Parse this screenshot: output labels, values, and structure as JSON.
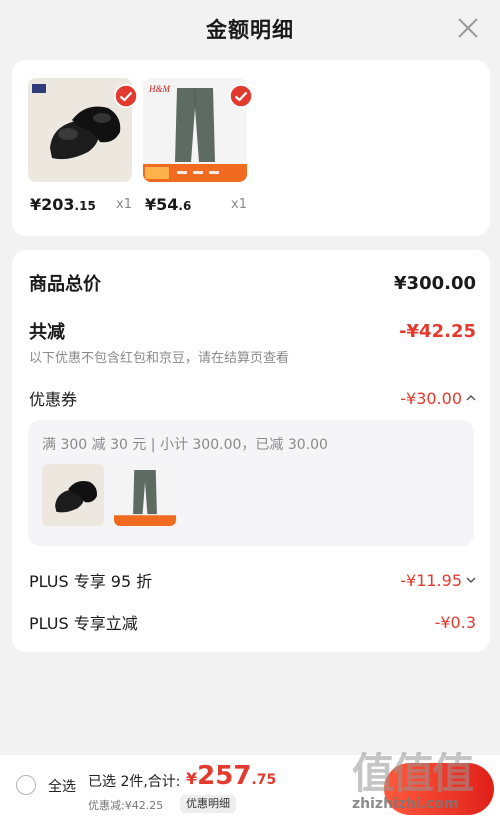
{
  "header": {
    "title": "金额明细",
    "close_icon": "close-icon"
  },
  "products": [
    {
      "name": "black leather shoes",
      "brand_tag": "HLA",
      "price_main": "¥203",
      "price_decimal": ".15",
      "qty": "x1"
    },
    {
      "name": "grey trousers",
      "brand_tag": "H&M",
      "price_main": "¥54",
      "price_decimal": ".6",
      "qty": "x1"
    }
  ],
  "summary": {
    "goods_total_label": "商品总价",
    "goods_total_value": "¥300.00",
    "total_reduce_label": "共减",
    "total_reduce_value": "-¥42.25",
    "note": "以下优惠不包含红包和京豆，请在结算页查看",
    "coupon_label": "优惠券",
    "coupon_value": "-¥30.00",
    "coupon_detail": "满 300 减 30 元 | 小计 300.00，已减 30.00",
    "plus95_label": "PLUS 专享 95 折",
    "plus95_value": "-¥11.95",
    "plus_direct_label": "PLUS 专享立减",
    "plus_direct_value": "-¥0.3"
  },
  "bottom": {
    "select_all": "全选",
    "selected_count": "已选 2件,合计:",
    "currency": "¥",
    "total_main": "257",
    "total_decimal": ".75",
    "discount_text": "优惠减:¥42.25",
    "detail_button": "优惠明细"
  },
  "watermark": {
    "chars": "值值值",
    "url": "zhizhizhi.com"
  },
  "colors": {
    "accent": "#e23a2e",
    "background": "#f2f2f2",
    "card": "#ffffff"
  }
}
